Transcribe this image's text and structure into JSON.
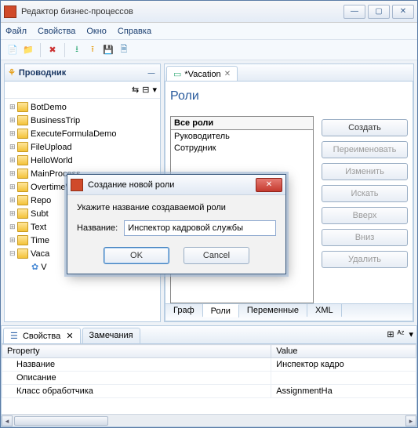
{
  "window": {
    "title": "Редактор бизнес-процессов"
  },
  "menu": {
    "file": "Файл",
    "properties": "Свойства",
    "window": "Окно",
    "help": "Справка"
  },
  "explorer": {
    "title": "Проводник",
    "items": [
      "BotDemo",
      "BusinessTrip",
      "ExecuteFormulaDemo",
      "FileUpload",
      "HelloWorld",
      "MainProcess",
      "OvertimeWork",
      "Repo",
      "Subt",
      "Text",
      "Time",
      "Vaca"
    ],
    "child": "V"
  },
  "editor": {
    "tab": "*Vacation",
    "heading": "Роли",
    "all_roles_label": "Все роли",
    "roles": [
      "Руководитель",
      "Сотрудник"
    ],
    "buttons": {
      "create": "Создать",
      "rename": "Переименовать",
      "edit": "Изменить",
      "search": "Искать",
      "up": "Вверх",
      "down": "Вниз",
      "delete": "Удалить"
    },
    "bottom_tabs": {
      "graph": "Граф",
      "roles": "Роли",
      "vars": "Переменные",
      "xml": "XML"
    }
  },
  "props": {
    "tab_props": "Свойства",
    "tab_notes": "Замечания",
    "col_property": "Property",
    "col_value": "Value",
    "rows": [
      {
        "p": "Название",
        "v": "Инспектор кадро"
      },
      {
        "p": "Описание",
        "v": ""
      },
      {
        "p": "Класс обработчика",
        "v": "AssignmentHa"
      }
    ]
  },
  "dialog": {
    "title": "Создание новой роли",
    "prompt": "Укажите название создаваемой роли",
    "field_label": "Название:",
    "value": "Инспектор кадровой службы",
    "ok": "OK",
    "cancel": "Cancel"
  }
}
